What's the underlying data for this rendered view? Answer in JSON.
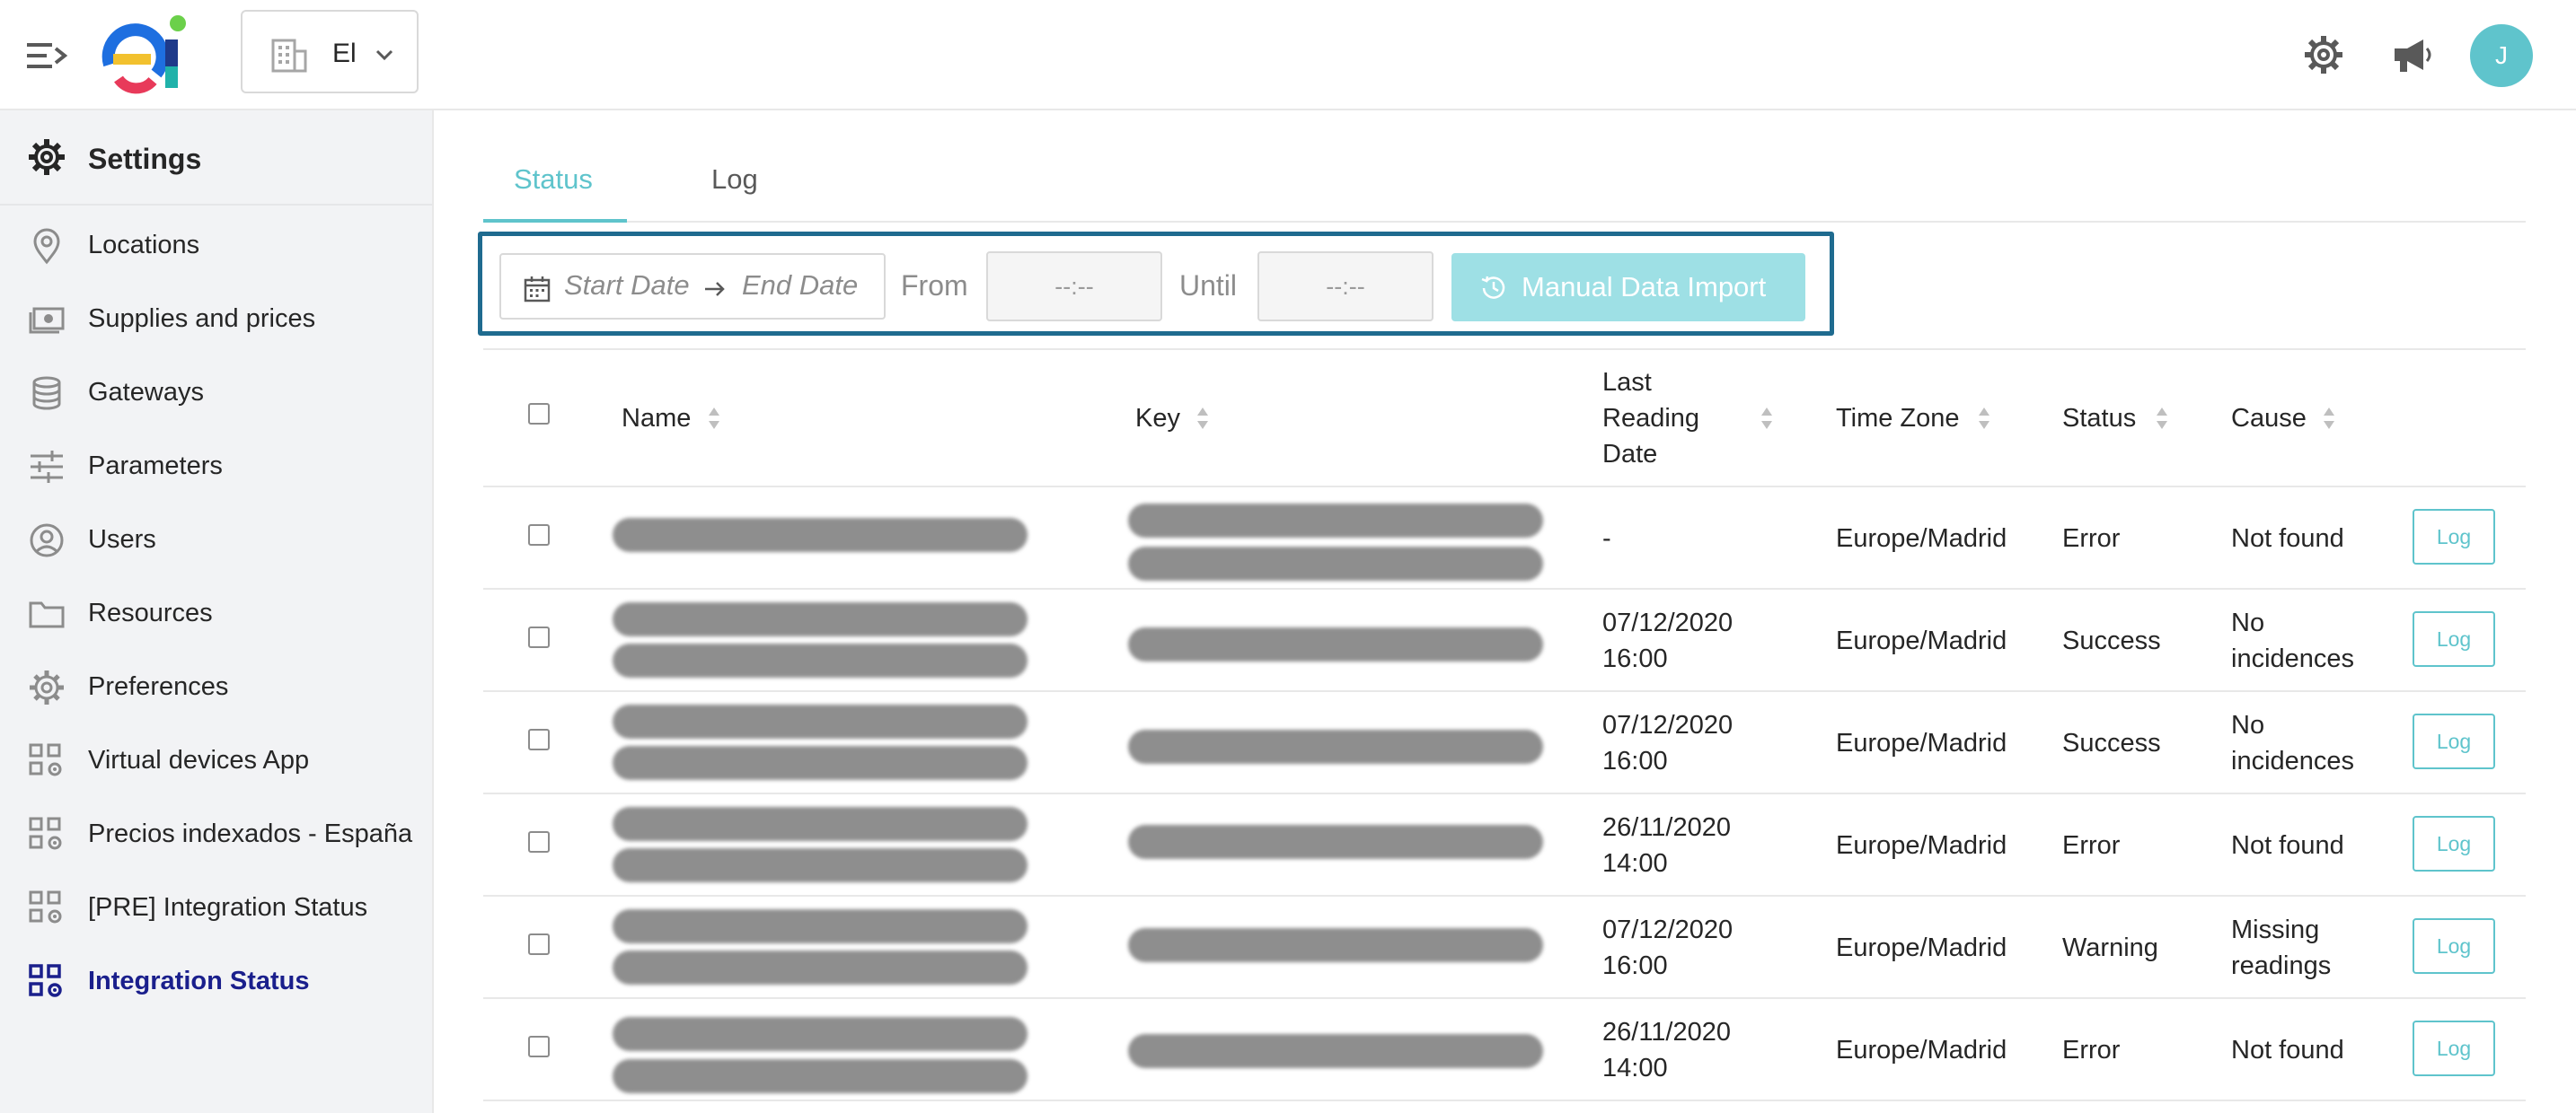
{
  "header": {
    "org_name": "El",
    "avatar_initial": "J",
    "icons": [
      "menu-unfold-icon",
      "building-icon",
      "chevron-down-icon",
      "gear-icon",
      "megaphone-icon"
    ]
  },
  "sidebar": {
    "title": "Settings",
    "items": [
      {
        "label": "Locations",
        "icon": "location-pin-icon"
      },
      {
        "label": "Supplies and prices",
        "icon": "money-icon"
      },
      {
        "label": "Gateways",
        "icon": "database-icon"
      },
      {
        "label": "Parameters",
        "icon": "sliders-icon"
      },
      {
        "label": "Users",
        "icon": "user-circle-icon"
      },
      {
        "label": "Resources",
        "icon": "folder-icon"
      },
      {
        "label": "Preferences",
        "icon": "gear-icon"
      },
      {
        "label": "Virtual devices App",
        "icon": "app-settings-icon"
      },
      {
        "label": "Precios indexados - España",
        "icon": "app-settings-icon"
      },
      {
        "label": "[PRE] Integration Status",
        "icon": "app-settings-icon"
      },
      {
        "label": "Integration Status",
        "icon": "app-settings-icon",
        "active": true
      }
    ]
  },
  "tabs": [
    {
      "label": "Status",
      "active": true
    },
    {
      "label": "Log",
      "active": false
    }
  ],
  "filters": {
    "start_placeholder": "Start Date",
    "end_placeholder": "End Date",
    "from_label": "From",
    "until_label": "Until",
    "from_placeholder": "--:--",
    "until_placeholder": "--:--",
    "import_button": "Manual Data Import"
  },
  "table": {
    "columns": {
      "name": "Name",
      "key": "Key",
      "last_reading_1": "Last",
      "last_reading_2": "Reading",
      "last_reading_3": "Date",
      "timezone": "Time Zone",
      "status": "Status",
      "cause": "Cause"
    },
    "log_label": "Log",
    "rows": [
      {
        "date1": "-",
        "date2": "",
        "timezone": "Europe/Madrid",
        "status": "Error",
        "cause1": "Not found",
        "cause2": ""
      },
      {
        "date1": "07/12/2020",
        "date2": "16:00",
        "timezone": "Europe/Madrid",
        "status": "Success",
        "cause1": "No",
        "cause2": "incidences"
      },
      {
        "date1": "07/12/2020",
        "date2": "16:00",
        "timezone": "Europe/Madrid",
        "status": "Success",
        "cause1": "No",
        "cause2": "incidences"
      },
      {
        "date1": "26/11/2020",
        "date2": "14:00",
        "timezone": "Europe/Madrid",
        "status": "Error",
        "cause1": "Not found",
        "cause2": ""
      },
      {
        "date1": "07/12/2020",
        "date2": "16:00",
        "timezone": "Europe/Madrid",
        "status": "Warning",
        "cause1": "Missing",
        "cause2": "readings"
      },
      {
        "date1": "26/11/2020",
        "date2": "14:00",
        "timezone": "Europe/Madrid",
        "status": "Error",
        "cause1": "Not found",
        "cause2": ""
      }
    ]
  },
  "colors": {
    "accent": "#5fc4cc",
    "active_nav": "#1a1f8c",
    "highlight_border": "#1f6b8f"
  }
}
